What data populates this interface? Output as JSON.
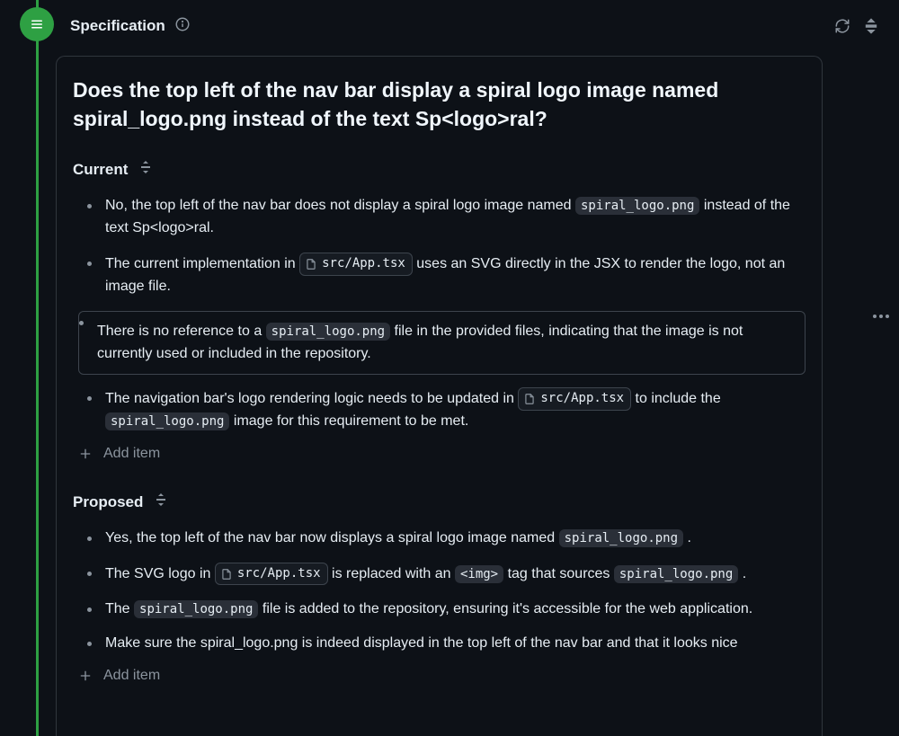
{
  "header": {
    "title": "Specification"
  },
  "question": "Does the top left of the nav bar display a spiral logo image named spiral_logo.png instead of the text Sp<logo>ral?",
  "sections": {
    "current": {
      "title": "Current",
      "items": [
        {
          "pre": "No, the top left of the nav bar does not display a spiral logo image named ",
          "code1": "spiral_logo.png",
          "post": " instead of the text Sp<logo>ral."
        },
        {
          "pre": "The current implementation in ",
          "file1": "src/App.tsx",
          "post": " uses an SVG directly in the JSX to render the logo, not an image file."
        },
        {
          "selected": true,
          "pre": "There is no reference to a ",
          "code1": "spiral_logo.png",
          "post": " file in the provided files, indicating that the image is not currently used or included in the repository."
        },
        {
          "pre": "The navigation bar's logo rendering logic needs to be updated in ",
          "file1": "src/App.tsx",
          "mid": " to include the ",
          "code1": "spiral_logo.png",
          "post": " image for this requirement to be met."
        }
      ]
    },
    "proposed": {
      "title": "Proposed",
      "items": [
        {
          "pre": "Yes, the top left of the nav bar now displays a spiral logo image named ",
          "code1": "spiral_logo.png",
          "post": " ."
        },
        {
          "pre": "The SVG logo in ",
          "file1": "src/App.tsx",
          "mid": " is replaced with an ",
          "code1": "<img>",
          "mid2": " tag that sources ",
          "code2": "spiral_logo.png",
          "post": " ."
        },
        {
          "pre": "The ",
          "code1": "spiral_logo.png",
          "post": " file is added to the repository, ensuring it's accessible for the web application."
        },
        {
          "pre": "Make sure the spiral_logo.png is indeed displayed in the top left of the nav bar and that it looks nice"
        }
      ]
    }
  },
  "addItemLabel": "Add item"
}
